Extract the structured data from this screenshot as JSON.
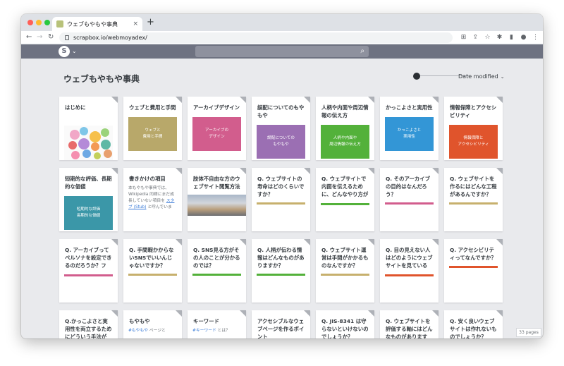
{
  "browser": {
    "tab_title": "ウェブもやもや事典",
    "tab_close": "×",
    "new_tab": "+",
    "url": "scrapbox.io/webmoyadex/",
    "nav": {
      "back": "←",
      "forward": "→",
      "reload": "↻"
    }
  },
  "app": {
    "logo": "S",
    "logo_caret": "⌄",
    "search_icon": "⌕"
  },
  "page": {
    "title": "ウェブもやもや事典",
    "sort_label": "Date modified",
    "sort_caret": "⌄",
    "page_count": "33 pages"
  },
  "colors": {
    "appbar": "#6e7281",
    "link": "#3d7dd8"
  },
  "cards": [
    {
      "title": "はじめに",
      "kind": "bubbles"
    },
    {
      "title": "ウェブと費用と手間",
      "kind": "thumb",
      "thumb_text": "ウェブと\n費用と手間",
      "color": "#b8a86a"
    },
    {
      "title": "アーカイブデザイン",
      "kind": "thumb",
      "thumb_text": "アーカイブの\nデザイン",
      "color": "#d25d8d"
    },
    {
      "title": "誤配についてのもやもや",
      "kind": "thumb",
      "thumb_text": "誤配についての\nもやもや",
      "color": "#9b6fb3"
    },
    {
      "title": "人柄や内面や周辺情報の伝え方",
      "kind": "thumb",
      "thumb_text": "人柄や内面や\n周辺情報の伝え方",
      "color": "#53b13a"
    },
    {
      "title": "かっこよさと実用性",
      "kind": "thumb",
      "thumb_text": "かっこよさと\n実用性",
      "color": "#3396d6"
    },
    {
      "title": "情報保障とアクセシビリティ",
      "kind": "thumb",
      "thumb_text": "情報保障と\nアクセシビリティ",
      "color": "#e0542c"
    },
    {
      "title": "短期的な評価、長期的な価値",
      "kind": "thumb",
      "thumb_text": "短期的な評価\n長期的な価値",
      "color": "#3b97a8"
    },
    {
      "title": "書きかけの項目",
      "kind": "desc",
      "desc_a": "本もやもや事典では、Wikipedia 同様にまだ成長していない項目を ",
      "desc_link": "スタブ (Stub)",
      "desc_b": " と呼んでいます。たいていは、詳"
    },
    {
      "title": "肢体不自由な方のウェブサイト閲覧方法",
      "kind": "photo"
    },
    {
      "title": "Q. ウェブサイトの寿命はどのくらいですか？",
      "kind": "bar",
      "color": "#c7b06d"
    },
    {
      "title": "Q. ウェブサイトで内面を伝えるために、どんなやり方があ…",
      "kind": "bar",
      "color": "#53b13a"
    },
    {
      "title": "Q. そのアーカイブの目的はなんだろう？",
      "kind": "bar",
      "color": "#d25d8d"
    },
    {
      "title": "Q. ウェブサイトを作るにはどんな工程があるんですか？",
      "kind": "bar",
      "color": "#c7b06d"
    },
    {
      "title": "Q. アーカイブってペルソナを設定できるのだろうか？フェ…",
      "kind": "bar",
      "color": "#d25d8d"
    },
    {
      "title": "Q. 手間暇かからないSNSでいいんじゃないですか？",
      "kind": "bar",
      "color": "#c7b06d"
    },
    {
      "title": "Q. SNS見る方がその人のことが分かるのでは？",
      "kind": "bar",
      "color": "#53b13a"
    },
    {
      "title": "Q. 人柄が伝わる情報はどんなものがありますか？",
      "kind": "bar",
      "color": "#53b13a"
    },
    {
      "title": "Q. ウェブサイト運営は手間がかかるものなんですか？",
      "kind": "bar",
      "color": "#c7b06d"
    },
    {
      "title": "Q. 目の見えない人はどのようにウェブサイトを見ているの…",
      "kind": "bar",
      "color": "#e0542c"
    },
    {
      "title": "Q. アクセシビリティってなんですか？",
      "kind": "bar",
      "color": "#e0542c"
    },
    {
      "title": "Q.かっこよさと実用性を両立するためにどういう手法があ…",
      "kind": "plain"
    },
    {
      "title": "もやもや",
      "kind": "tag",
      "tag": "#もやもや",
      "tag_rest": " ページと"
    },
    {
      "title": "キーワード",
      "kind": "tag",
      "tag": "#キーワード",
      "tag_rest": " とは？"
    },
    {
      "title": "アクセシブルなウェブページを作るポイント",
      "kind": "plain"
    },
    {
      "title": "Q. JIS-8341 は守らないといけないのでしょうか？",
      "kind": "plain"
    },
    {
      "title": "Q. ウェブサイトを評価する軸にはどんなものがありますか？",
      "kind": "plain"
    },
    {
      "title": "Q. 安く良いウェブサイトは作れないものでしょうか？",
      "kind": "plain"
    }
  ]
}
